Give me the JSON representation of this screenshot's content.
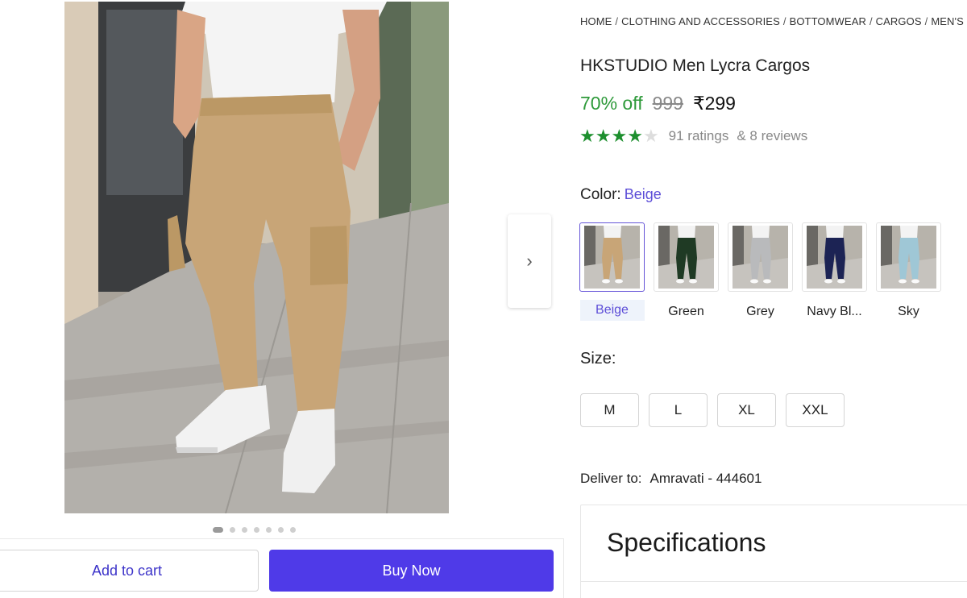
{
  "breadcrumb": [
    "HOME",
    "CLOTHING AND ACCESSORIES",
    "BOTTOMWEAR",
    "CARGOS",
    "MEN'S CARGOS"
  ],
  "product": {
    "title": "HKSTUDIO Men Lycra Cargos",
    "discount": "70% off",
    "mrp": "999",
    "price": "₹299",
    "rating": 4,
    "rating_max": 5,
    "ratings_count": "91 ratings",
    "reviews_count": "& 8 reviews"
  },
  "gallery": {
    "image_count": 7,
    "active_index": 0,
    "next_icon": "chevron-right-icon"
  },
  "color": {
    "label": "Color:",
    "selected": "Beige",
    "options": [
      {
        "label": "Beige",
        "pant_color": "#c8a577"
      },
      {
        "label": "Green",
        "pant_color": "#1f3a24"
      },
      {
        "label": "Grey",
        "pant_color": "#b9babc"
      },
      {
        "label": "Navy Bl...",
        "pant_color": "#1c2354"
      },
      {
        "label": "Sky",
        "pant_color": "#9fc7d6"
      }
    ]
  },
  "size": {
    "label": "Size:",
    "options": [
      "M",
      "L",
      "XL",
      "XXL"
    ]
  },
  "delivery": {
    "label": "Deliver to:",
    "location": "Amravati - 444601"
  },
  "specifications": {
    "title": "Specifications"
  },
  "actions": {
    "add_to_cart": "Add to cart",
    "buy_now": "Buy Now"
  },
  "colors": {
    "accent": "#4f3ae8",
    "discount_green": "#2e9a3a",
    "star_green": "#1d8f2e"
  }
}
